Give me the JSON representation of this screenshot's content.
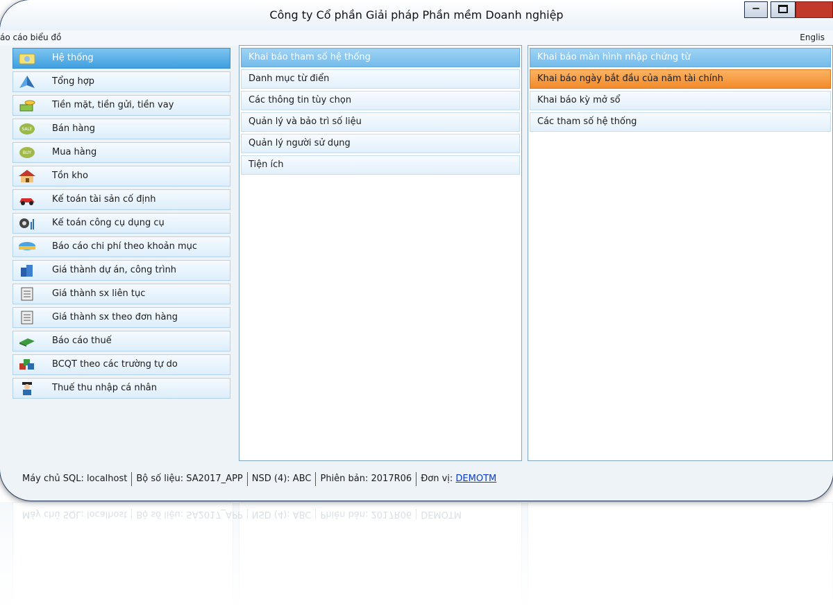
{
  "window": {
    "title": "Công ty Cổ phần Giải pháp Phần mềm Doanh nghiệp"
  },
  "menu": {
    "left": "áo cáo biểu đồ",
    "right": "Englis"
  },
  "nav": {
    "items": [
      {
        "label": "Hệ thống",
        "icon": "system-icon"
      },
      {
        "label": "Tổng hợp",
        "icon": "summary-icon"
      },
      {
        "label": "Tiền mặt, tiền gửi, tiền vay",
        "icon": "money-icon"
      },
      {
        "label": "Bán hàng",
        "icon": "sale-icon"
      },
      {
        "label": "Mua hàng",
        "icon": "buy-icon"
      },
      {
        "label": "Tồn kho",
        "icon": "warehouse-icon"
      },
      {
        "label": "Kế toán tài sản cố định",
        "icon": "car-icon"
      },
      {
        "label": "Kế toán công cụ dụng cụ",
        "icon": "tools-icon"
      },
      {
        "label": "Báo cáo chi phí theo khoản mục",
        "icon": "report-icon"
      },
      {
        "label": "Giá thành dự án, công trình",
        "icon": "building-icon"
      },
      {
        "label": "Giá thành sx liên tục",
        "icon": "document-icon"
      },
      {
        "label": "Giá thành sx theo đơn hàng",
        "icon": "document-icon"
      },
      {
        "label": "Báo cáo thuế",
        "icon": "book-icon"
      },
      {
        "label": "BCQT theo các trường tự do",
        "icon": "cubes-icon"
      },
      {
        "label": "Thuế thu nhập cá nhân",
        "icon": "person-icon"
      }
    ]
  },
  "middle": {
    "items": [
      "Khai báo tham số hệ thống",
      "Danh mục từ điển",
      "Các thông tin tùy chọn",
      "Quản lý và bảo trì số liệu",
      "Quản lý người sử dụng",
      "Tiện ích"
    ]
  },
  "right": {
    "items": [
      "Khai báo màn hình nhập chứng từ",
      "Khai báo ngày bắt đầu của năm tài chính",
      "Khai báo kỳ mở sổ",
      "Các tham số hệ thống"
    ]
  },
  "status": {
    "sql": "Máy chủ SQL: localhost",
    "dataset": "Bộ số liệu: SA2017_APP",
    "user": "NSD (4): ABC",
    "version": "Phiên bản: 2017R06",
    "unit_label": "Đơn vị:",
    "unit_value": "DEMOTM"
  },
  "colors": {
    "accent_blue": "#3f9fdf",
    "highlight_orange": "#f28a2a",
    "close_red": "#c0392b"
  }
}
